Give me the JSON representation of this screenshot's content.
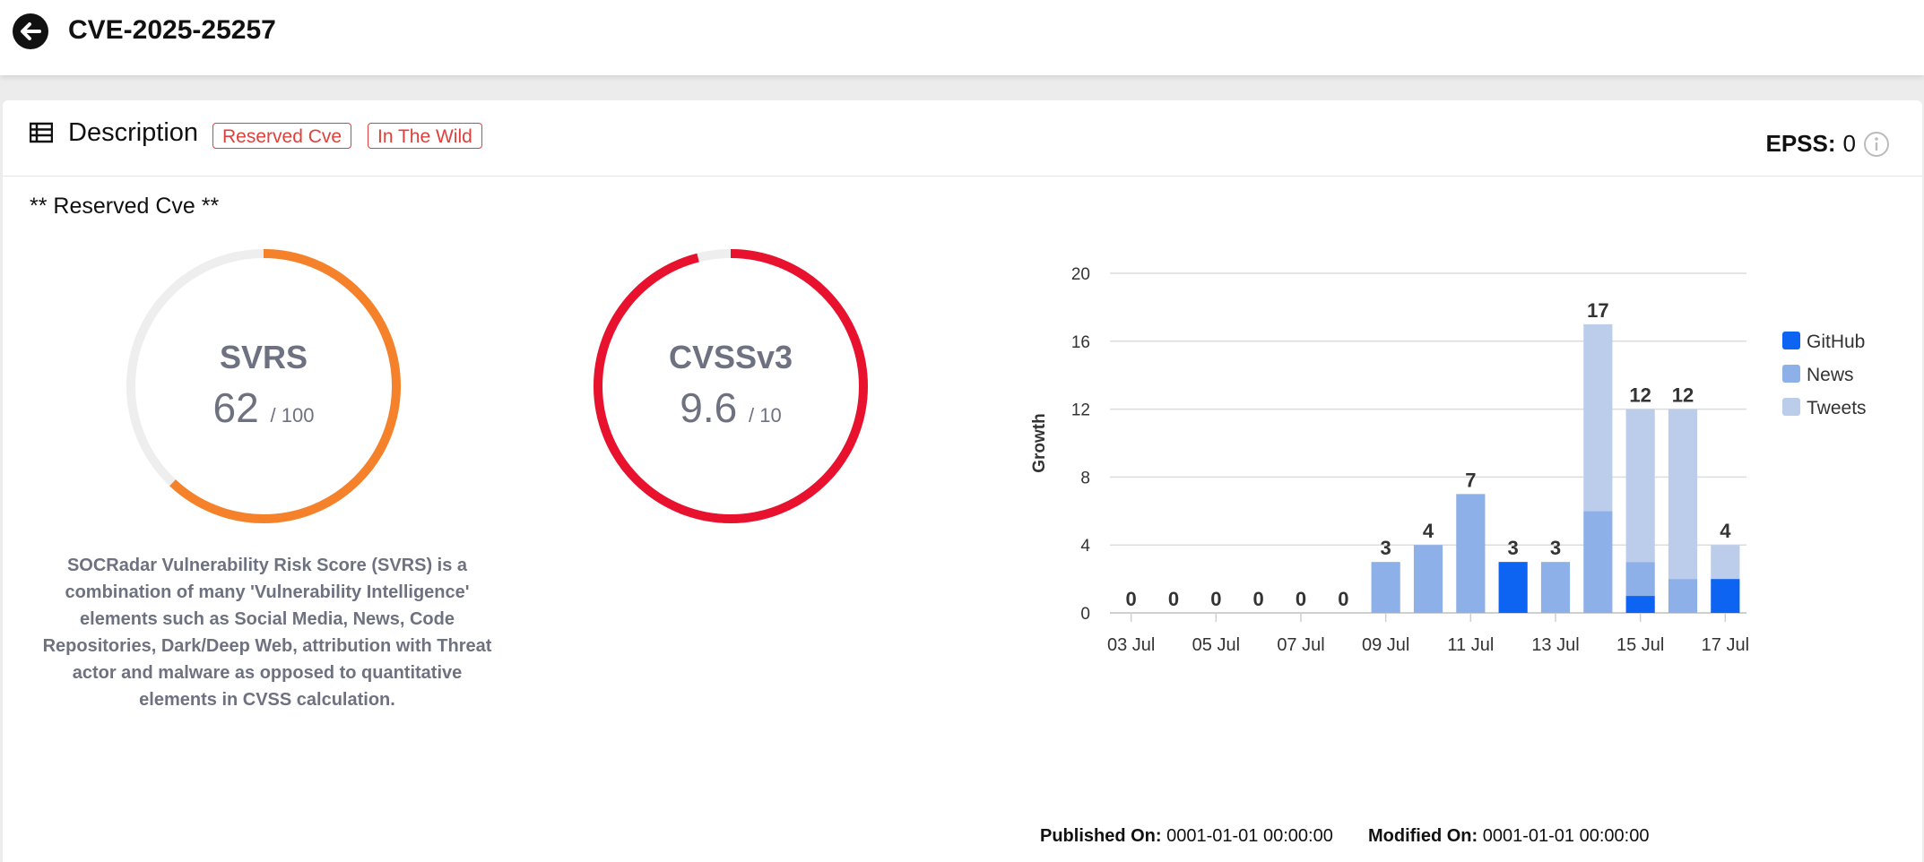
{
  "header": {
    "title": "CVE-2025-25257",
    "back_icon": "arrow-left-icon"
  },
  "description": {
    "title": "Description",
    "tags": [
      "Reserved Cve",
      "In The Wild"
    ],
    "epss_label": "EPSS:",
    "epss_value": "0",
    "text": "** Reserved Cve **"
  },
  "svrs": {
    "name": "SVRS",
    "value": "62",
    "max_label": "/ 100",
    "fraction": 0.62,
    "color": "#f5822a",
    "description": "SOCRadar Vulnerability Risk Score (SVRS) is a combination of many 'Vulnerability Intelligence' elements such as Social Media, News, Code Repositories, Dark/Deep Web, attribution with Threat actor and malware as opposed to quantitative elements in CVSS calculation."
  },
  "cvss": {
    "name": "CVSSv3",
    "value": "9.6",
    "max_label": "/ 10",
    "fraction": 0.96,
    "color": "#e8122f"
  },
  "chart_data": {
    "type": "bar",
    "stacked": true,
    "ylabel": "Growth",
    "ylim": [
      0,
      20
    ],
    "yticks": [
      0,
      4,
      8,
      12,
      16,
      20
    ],
    "categories": [
      "03 Jul",
      "04 Jul",
      "05 Jul",
      "06 Jul",
      "07 Jul",
      "08 Jul",
      "09 Jul",
      "10 Jul",
      "11 Jul",
      "12 Jul",
      "13 Jul",
      "14 Jul",
      "15 Jul",
      "16 Jul",
      "17 Jul"
    ],
    "xtick_labels": [
      "03 Jul",
      "05 Jul",
      "07 Jul",
      "09 Jul",
      "11 Jul",
      "13 Jul",
      "15 Jul",
      "17 Jul"
    ],
    "series": [
      {
        "name": "GitHub",
        "color": "#0d63f2",
        "values": [
          0,
          0,
          0,
          0,
          0,
          0,
          0,
          0,
          0,
          3,
          0,
          0,
          1,
          0,
          2
        ]
      },
      {
        "name": "News",
        "color": "#8eb0e8",
        "values": [
          0,
          0,
          0,
          0,
          0,
          0,
          3,
          4,
          7,
          0,
          3,
          6,
          2,
          2,
          0
        ]
      },
      {
        "name": "Tweets",
        "color": "#bccdec",
        "values": [
          0,
          0,
          0,
          0,
          0,
          0,
          0,
          0,
          0,
          0,
          0,
          11,
          9,
          10,
          2
        ]
      }
    ],
    "totals": [
      0,
      0,
      0,
      0,
      0,
      0,
      3,
      4,
      7,
      3,
      3,
      17,
      12,
      12,
      4
    ],
    "legend_position": "right",
    "grid": true
  },
  "footer": {
    "published_label": "Published On:",
    "published_value": "0001-01-01 00:00:00",
    "modified_label": "Modified On:",
    "modified_value": "0001-01-01 00:00:00"
  }
}
